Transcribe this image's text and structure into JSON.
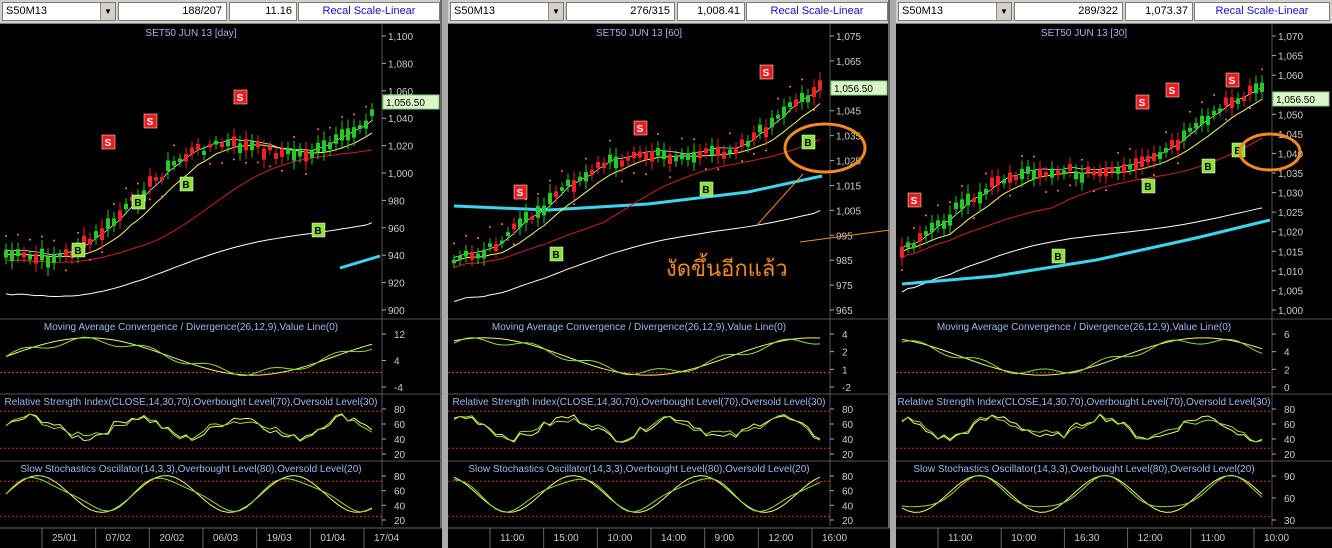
{
  "panels": [
    {
      "symbol": "S50M13",
      "bar_count": "188/207",
      "value": "11.16",
      "recal_label": "Recal Scale-Linear",
      "chart_title": "SET50 JUN 13   [day]",
      "price_labels": [
        "1,100",
        "1,080",
        "1,060",
        "1,040",
        "1,020",
        "1,000",
        "980",
        "960",
        "940",
        "920",
        "900"
      ],
      "price_range": [
        895,
        1105
      ],
      "current_price": "1,056.50",
      "macd_title": "Moving Average Convergence / Divergence(26,12,9),Value Line(0)",
      "macd_labels": [
        "12",
        "4",
        "-4"
      ],
      "rsi_title": "Relative Strength Index(CLOSE,14,30,70),Overbought Level(70),Oversold Level(30)",
      "rsi_labels": [
        "80",
        "60",
        "40",
        "20"
      ],
      "stoch_title": "Slow Stochastics Oscillator(14,3,3),Overbought Level(80),Oversold Level(20)",
      "stoch_labels": [
        "80",
        "60",
        "40",
        "20"
      ],
      "date_labels": [
        "25/01",
        "07/02",
        "20/02",
        "06/03",
        "19/03",
        "01/04",
        "17/04"
      ]
    },
    {
      "symbol": "S50M13",
      "bar_count": "276/315",
      "value": "1,008.41",
      "recal_label": "Recal Scale-Linear",
      "chart_title": "SET50 JUN 13   [60]",
      "price_labels": [
        "1,075",
        "1,065",
        "1,055",
        "1,045",
        "1,035",
        "1,025",
        "1,015",
        "1,005",
        "995",
        "985",
        "975",
        "965"
      ],
      "price_range": [
        962,
        1078
      ],
      "current_price": "1,056.50",
      "annotation": "งัดขึ้นอีกแล้ว",
      "macd_title": "Moving Average Convergence / Divergence(26,12,9),Value Line(0)",
      "macd_labels": [
        "4",
        "2",
        "1",
        "-2"
      ],
      "rsi_title": "Relative Strength Index(CLOSE,14,30,70),Overbought Level(70),Oversold Level(30)",
      "rsi_labels": [
        "80",
        "60",
        "40",
        "20"
      ],
      "stoch_title": "Slow Stochastics Oscillator(14,3,3),Overbought Level(80),Oversold Level(20)",
      "stoch_labels": [
        "80",
        "60",
        "40",
        "20"
      ],
      "date_labels": [
        "11:00",
        "15:00",
        "10:00",
        "14:00",
        "9:00",
        "12:00",
        "16:00"
      ]
    },
    {
      "symbol": "S50M13",
      "bar_count": "289/322",
      "value": "1,073.37",
      "recal_label": "Recal Scale-Linear",
      "chart_title": "SET50 JUN 13   [30]",
      "price_labels": [
        "1,070",
        "1,065",
        "1,060",
        "1,055",
        "1,050",
        "1,045",
        "1,040",
        "1,035",
        "1,030",
        "1,025",
        "1,020",
        "1,015",
        "1,010",
        "1,005",
        "1,000"
      ],
      "price_range": [
        996,
        1073
      ],
      "current_price": "1,056.50",
      "macd_title": "Moving Average Convergence / Divergence(26,12,9),Value Line(0)",
      "macd_labels": [
        "6",
        "4",
        "2",
        "0"
      ],
      "rsi_title": "Relative Strength Index(CLOSE,14,30,70),Overbought Level(70),Oversold Level(30)",
      "rsi_labels": [
        "80",
        "60",
        "40",
        "20"
      ],
      "stoch_title": "Slow Stochastics Oscillator(14,3,3),Overbought Level(80),Oversold Level(20)",
      "stoch_labels": [
        "90",
        "60",
        "30"
      ],
      "date_labels": [
        "11:00",
        "10:00",
        "16:30",
        "12:00",
        "11:00",
        "10:00"
      ]
    }
  ],
  "signals": {
    "buy": "B",
    "sell": "S"
  },
  "colors": {
    "up": "#22cc22",
    "down": "#ee2222",
    "ma_white": "#ffffff",
    "ma_yellow": "#f5f56a",
    "ma_red": "#d02020",
    "trend_cyan": "#3ad6ee",
    "signal_buy": "#8be03a",
    "signal_sell": "#ee1c1c",
    "annotation": "#f28a1f",
    "axis_text": "#cccccc",
    "title": "#9db8f0"
  }
}
